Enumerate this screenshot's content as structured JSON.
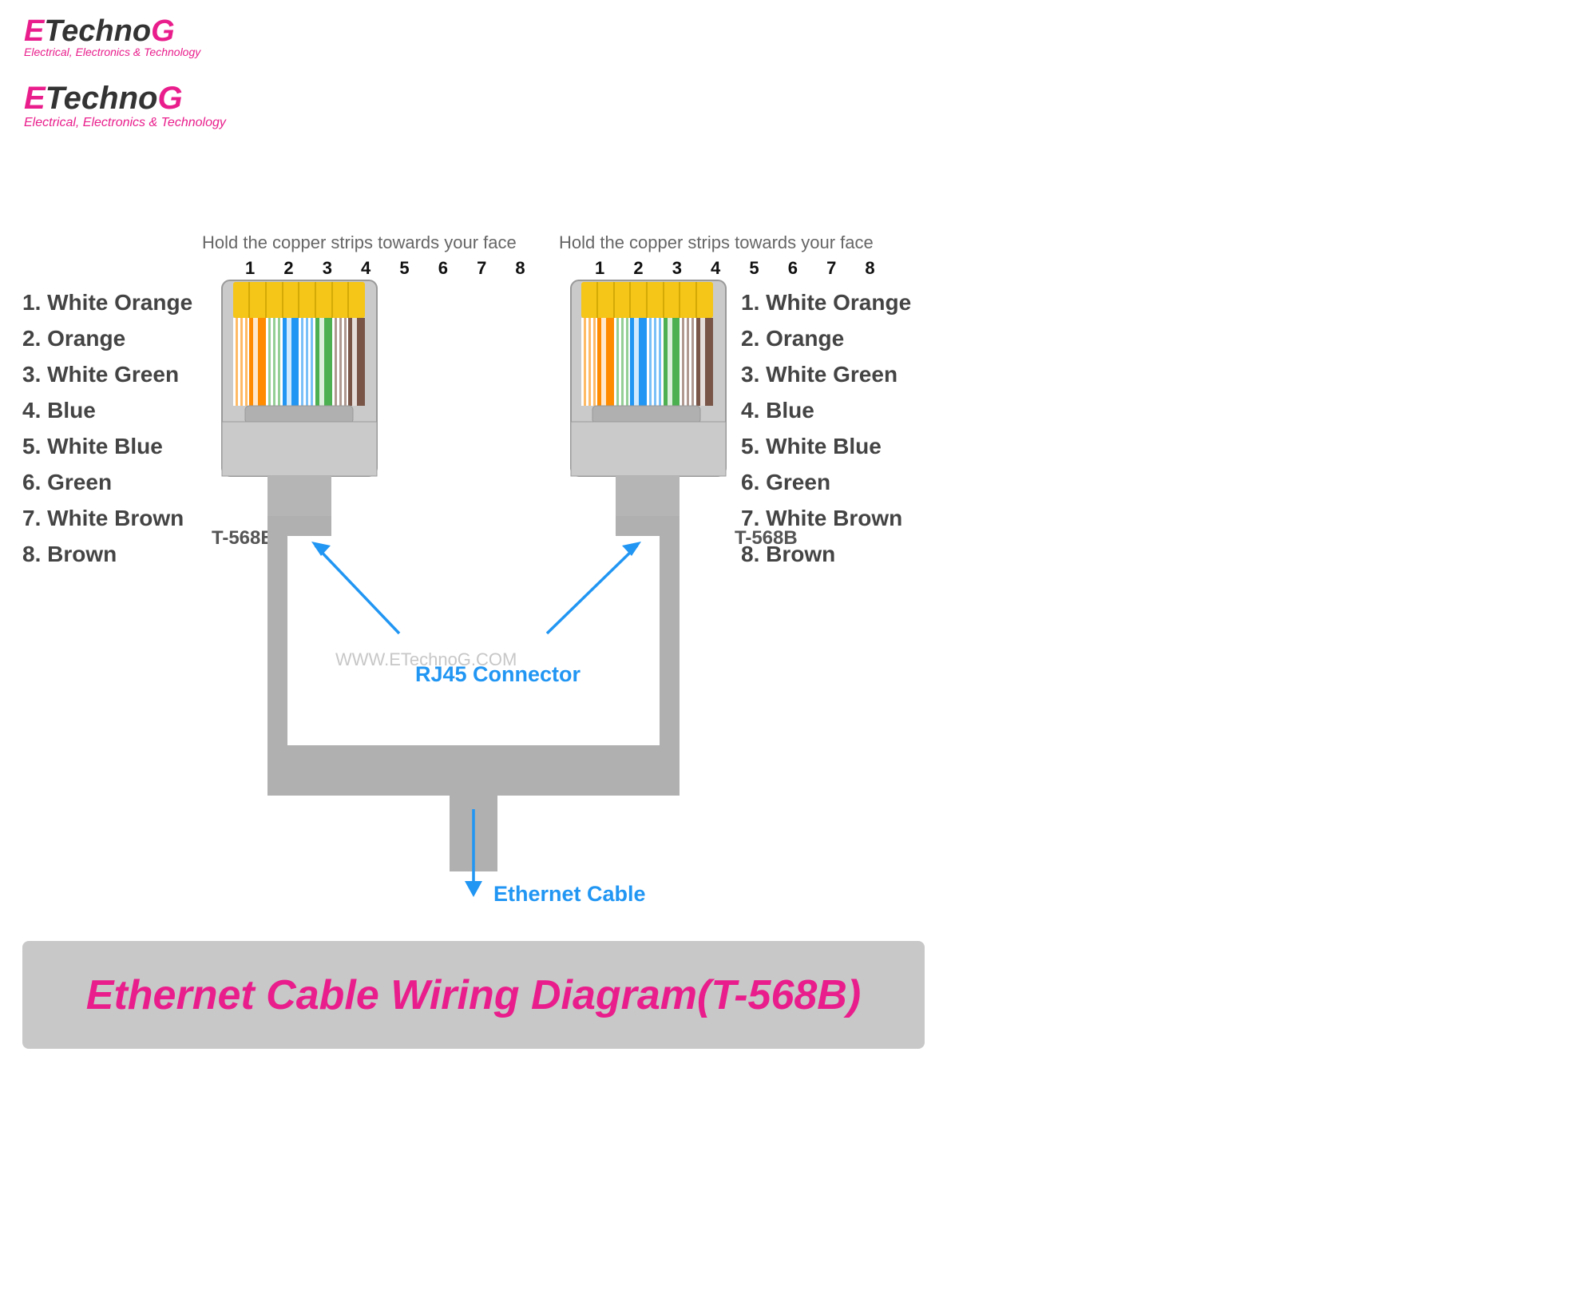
{
  "logo": {
    "e": "E",
    "techno": "Techno",
    "g": "G",
    "subtitle": "Electrical, Electronics & Technology"
  },
  "left_connector": {
    "instruction": "Hold the copper strips towards your face",
    "label": "T-568B",
    "pins": "1 2 3 4 5 6 7 8",
    "wires": [
      "1. White Orange",
      "2. Orange",
      "3. White Green",
      "4. Blue",
      "5. White Blue",
      "6. Green",
      "7. White Brown",
      "8. Brown"
    ]
  },
  "right_connector": {
    "instruction": "Hold the copper strips towards your face",
    "label": "T-568B",
    "pins": "1 2 3 4 5 6 7 8",
    "wires": [
      "1. White Orange",
      "2. Orange",
      "3. White Green",
      "4. Blue",
      "5. White Blue",
      "6. Green",
      "7. White Brown",
      "8. Brown"
    ]
  },
  "center_labels": {
    "connector": "RJ45 Connector",
    "cable": "Ethernet Cable"
  },
  "watermark": "WWW.ETechnoG.COM",
  "banner": {
    "text": "Ethernet Cable Wiring Diagram(T-568B)"
  }
}
